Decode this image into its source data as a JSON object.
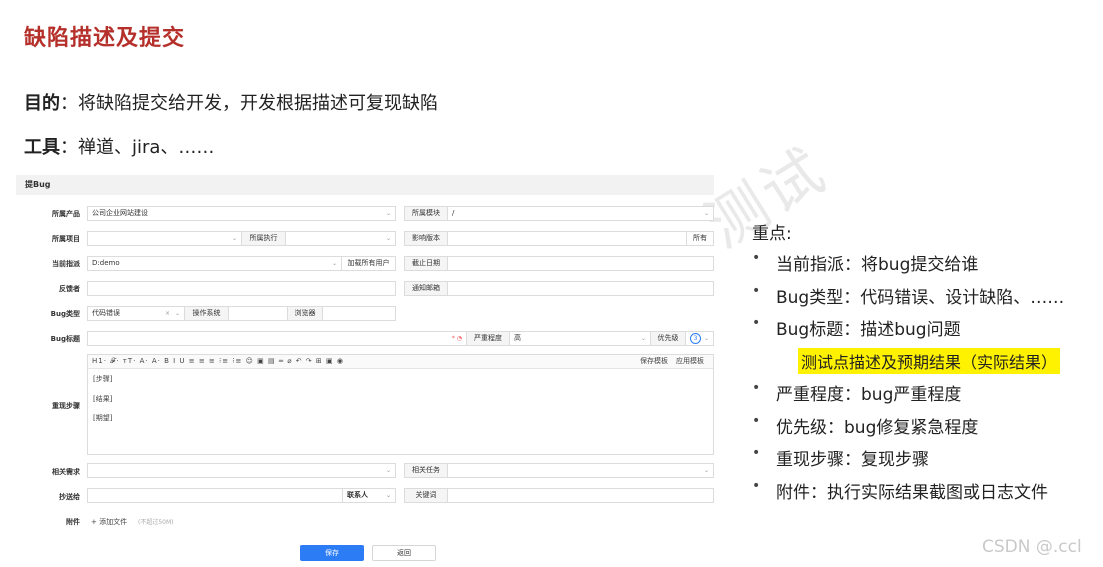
{
  "slide": {
    "title": "缺陷描述及提交",
    "purpose_label": "目的",
    "purpose_text": "：将缺陷提交给开发，开发根据描述可复现缺陷",
    "tools_label": "工具",
    "tools_text": "：禅道、jira、……",
    "watermark": "测试"
  },
  "form": {
    "header": "提Bug",
    "labels": {
      "product": "所属产品",
      "project": "所属项目",
      "assignee": "当前指派",
      "feedback": "反馈者",
      "bug_type": "Bug类型",
      "bug_title": "Bug标题",
      "repro": "重现步骤",
      "related_req": "相关需求",
      "cc": "抄送给",
      "attachment": "附件"
    },
    "product_value": "公司企业网站建设",
    "module_label": "所属模块",
    "module_value": "/",
    "exec_label": "所属执行",
    "version_label": "影响版本",
    "version_addon": "所有",
    "assignee_value": "D:demo",
    "load_all_users": "加载所有用户",
    "deadline_label": "截止日期",
    "notify_label": "通知邮箱",
    "bug_type_value": "代码错误",
    "os_label": "操作系统",
    "browser_label": "浏览器",
    "severity_label": "严重程度",
    "severity_value": "高",
    "priority_label": "优先级",
    "priority_value": "3",
    "editor_toolbar": "H1·  𝓕·  тT·   A·  A·  B  I  U   ≡  ≡  ≡  ⁝≡  ⁝≡   ☺  ▣  ▤  ═   ⌀  ↶  ↷  ⊞  ▣  ◉",
    "save_template": "保存模板",
    "apply_template": "应用模板",
    "steps": "[步骤]",
    "result": "[结果]",
    "expected": "[期望]",
    "related_task_label": "相关任务",
    "contact_label": "联系人",
    "keyword_label": "关键词",
    "add_file": "+ 添加文件",
    "file_limit": "(不超过50M)",
    "save_button": "保存",
    "back_button": "返回"
  },
  "focus": {
    "title": "重点:",
    "bullets": [
      "当前指派：将bug提交给谁",
      "Bug类型：代码错误、设计缺陷、……",
      "Bug标题：描述bug问题",
      "严重程度：bug严重程度",
      "优先级：bug修复紧急程度",
      "重现步骤：复现步骤",
      "附件：执行实际结果截图或日志文件"
    ],
    "highlight": "测试点描述及预期结果（实际结果）",
    "highlight_color": "#fff200"
  },
  "footer": {
    "csdn": "CSDN @.ccl"
  }
}
